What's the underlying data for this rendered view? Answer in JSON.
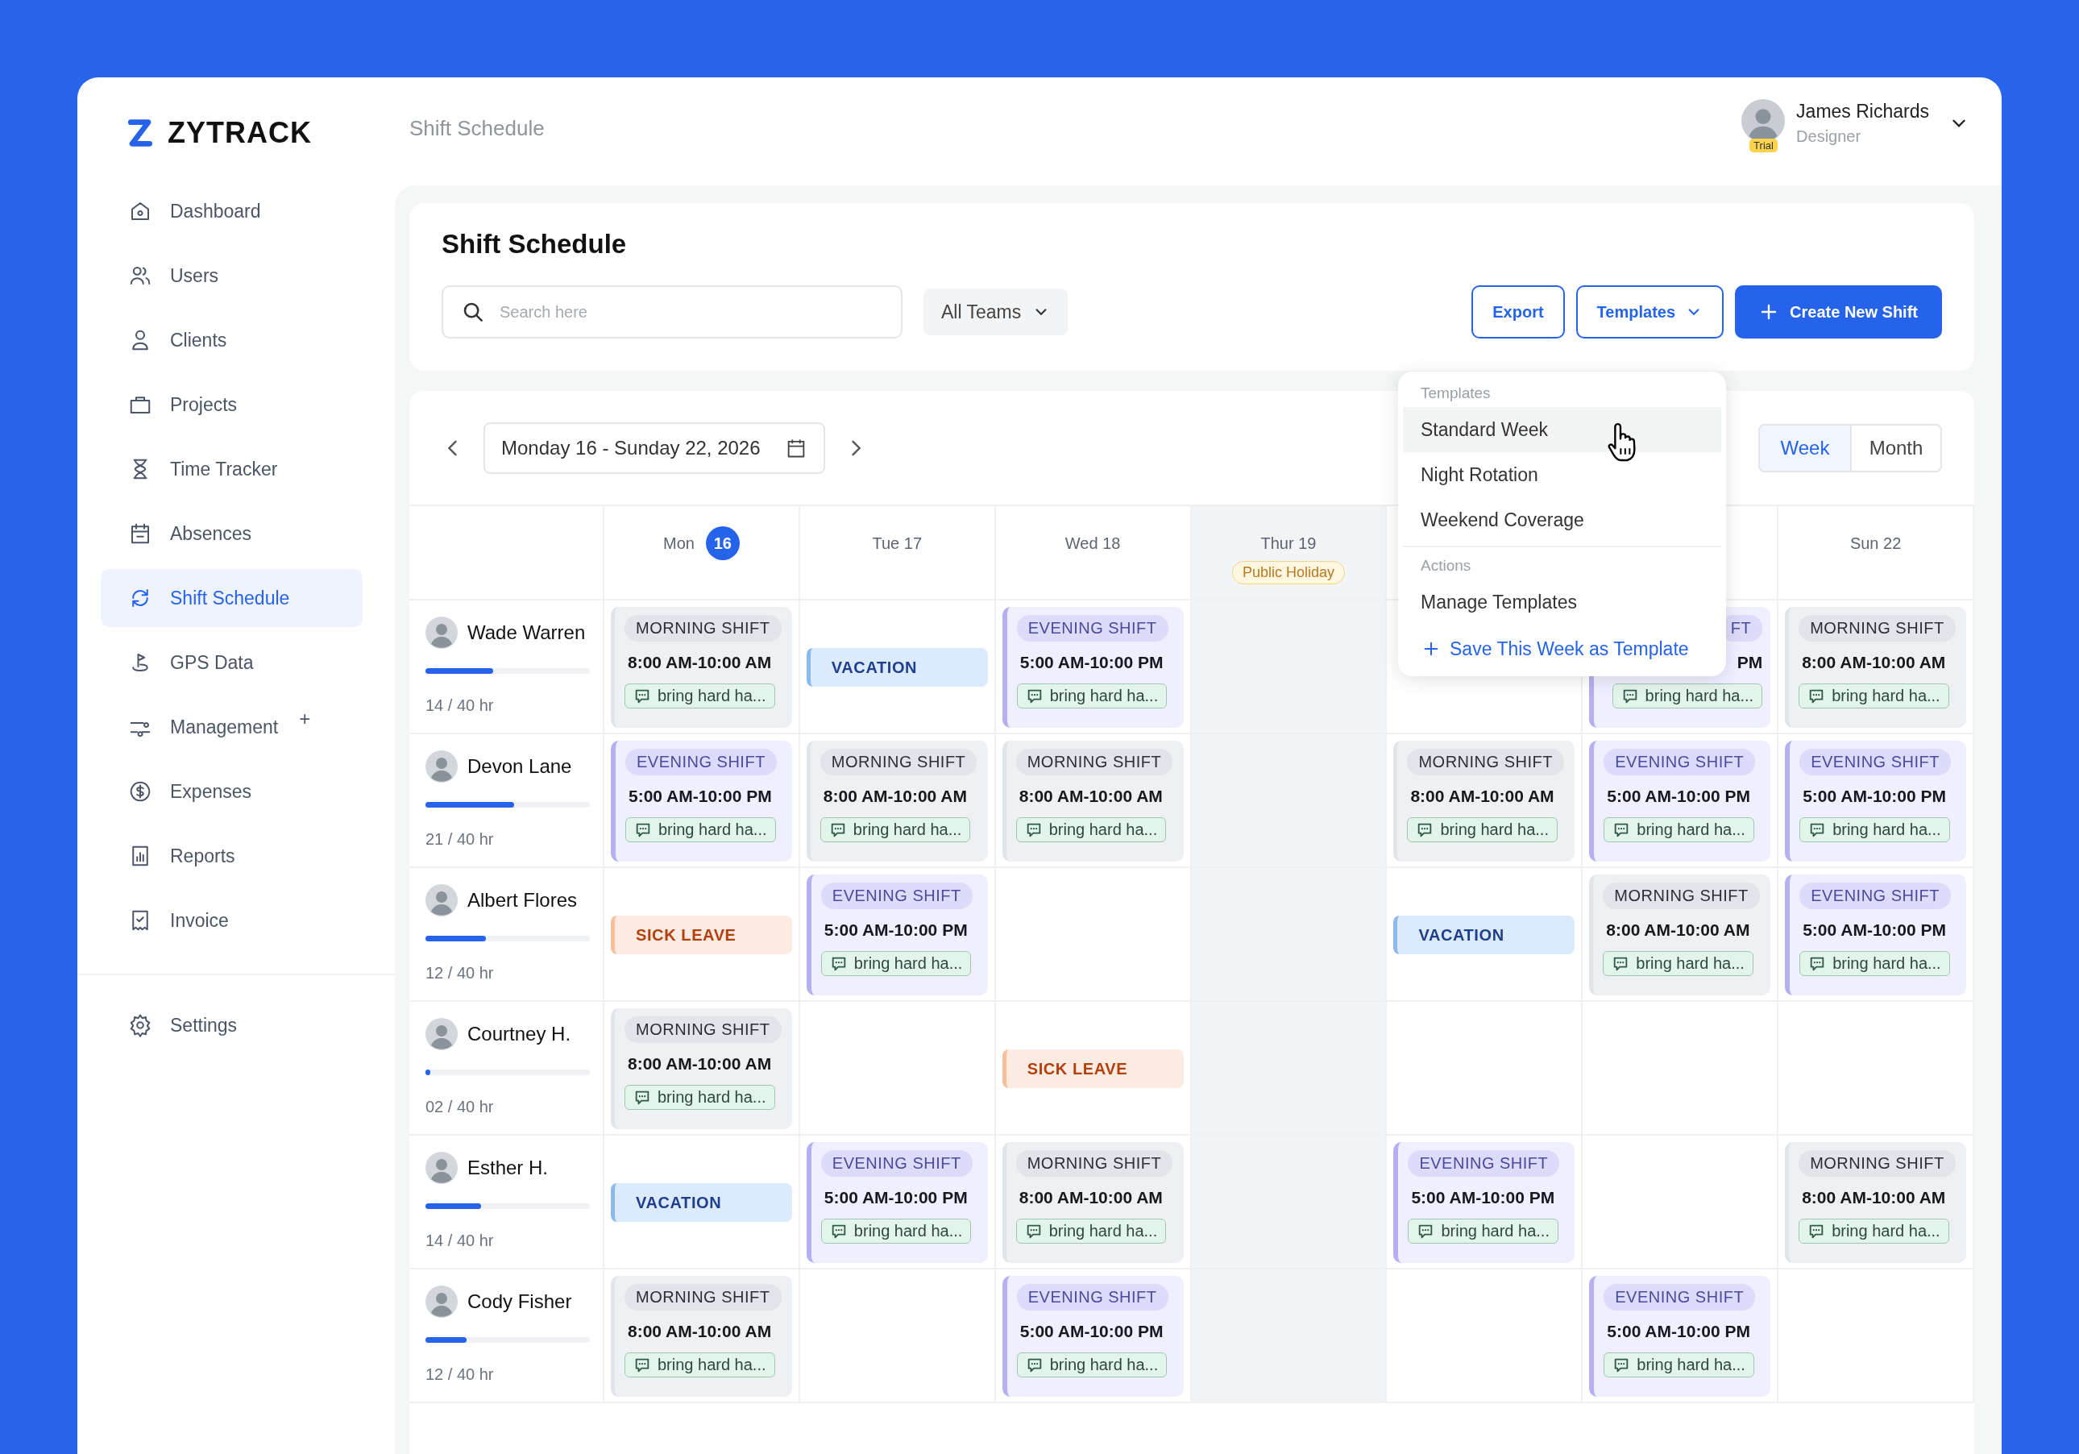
{
  "app": {
    "logo": "ZYTRACK"
  },
  "sidebar": {
    "items": [
      {
        "label": "Dashboard",
        "selected": false
      },
      {
        "label": "Users",
        "selected": false
      },
      {
        "label": "Clients",
        "selected": false
      },
      {
        "label": "Projects",
        "selected": false
      },
      {
        "label": "Time Tracker",
        "selected": false
      },
      {
        "label": "Absences",
        "selected": false
      },
      {
        "label": "Shift Schedule",
        "selected": true
      },
      {
        "label": "GPS Data",
        "selected": false
      },
      {
        "label": "Management",
        "selected": false,
        "badge": "+"
      },
      {
        "label": "Expenses",
        "selected": false
      },
      {
        "label": "Reports",
        "selected": false
      },
      {
        "label": "Invoice",
        "selected": false
      }
    ],
    "footer_items": [
      {
        "label": "Settings",
        "selected": false
      }
    ]
  },
  "header": {
    "breadcrumb": "Shift Schedule",
    "user": {
      "name": "James Richards",
      "role": "Designer",
      "badge": "Trial"
    }
  },
  "page": {
    "title": "Shift Schedule",
    "search": {
      "placeholder": "Search here"
    },
    "team_filter": "All Teams",
    "export": "Export",
    "templates": "Templates",
    "create": "Create New Shift"
  },
  "schedule": {
    "date_range": "Monday 16 - Sunday 22, 2026",
    "views": [
      {
        "label": "Week",
        "selected": true
      },
      {
        "label": "Month",
        "selected": false
      }
    ],
    "days": [
      {
        "label": "Mon",
        "badge": "16",
        "holiday": false
      },
      {
        "label": "Tue 17",
        "holiday": false
      },
      {
        "label": "Wed 18",
        "holiday": false
      },
      {
        "label": "Thur 19",
        "tag": "Public Holiday",
        "holiday": true
      },
      {
        "holiday": false
      },
      {
        "holiday": false
      },
      {
        "label": "Sun 22",
        "holiday": false
      }
    ],
    "rows": [
      {
        "name": "Wade Warren",
        "hours": "14 / 40 hr",
        "level": 0.41,
        "cells": [
          {
            "kind": "morning",
            "label": "MORNING SHIFT",
            "time": "8:00 AM-10:00 AM",
            "note": "bring hard ha..."
          },
          {
            "kind": "vacation",
            "label": "VACATION"
          },
          {
            "kind": "evening",
            "label": "EVENING SHIFT",
            "time": "5:00 AM-10:00 PM",
            "note": "bring hard ha..."
          },
          {
            "kind": "empty"
          },
          {
            "kind": "empty"
          },
          {
            "kind": "evening",
            "label": "FT",
            "time": "PM",
            "note": "bring hard ha...",
            "partial": true
          },
          {
            "kind": "morning",
            "label": "MORNING SHIFT",
            "time": "8:00 AM-10:00 AM",
            "note": "bring hard ha..."
          }
        ]
      },
      {
        "name": "Devon Lane",
        "hours": "21 / 40 hr",
        "level": 0.54,
        "cells": [
          {
            "kind": "evening",
            "label": "EVENING SHIFT",
            "time": "5:00 AM-10:00 PM",
            "note": "bring hard ha..."
          },
          {
            "kind": "morning",
            "label": "MORNING SHIFT",
            "time": "8:00 AM-10:00 AM",
            "note": "bring hard ha..."
          },
          {
            "kind": "morning",
            "label": "MORNING SHIFT",
            "time": "8:00 AM-10:00 AM",
            "note": "bring hard ha..."
          },
          {
            "kind": "empty"
          },
          {
            "kind": "morning",
            "label": "MORNING SHIFT",
            "time": "8:00 AM-10:00 AM",
            "note": "bring hard ha..."
          },
          {
            "kind": "evening",
            "label": "EVENING SHIFT",
            "time": "5:00 AM-10:00 PM",
            "note": "bring hard ha..."
          },
          {
            "kind": "evening",
            "label": "EVENING SHIFT",
            "time": "5:00 AM-10:00 PM",
            "note": "bring hard ha..."
          }
        ]
      },
      {
        "name": "Albert Flores",
        "hours": "12 / 40 hr",
        "level": 0.37,
        "cells": [
          {
            "kind": "sick",
            "label": "SICK LEAVE"
          },
          {
            "kind": "evening",
            "label": "EVENING SHIFT",
            "time": "5:00 AM-10:00 PM",
            "note": "bring hard ha..."
          },
          {
            "kind": "empty"
          },
          {
            "kind": "empty"
          },
          {
            "kind": "vacation",
            "label": "VACATION"
          },
          {
            "kind": "morning",
            "label": "MORNING SHIFT",
            "time": "8:00 AM-10:00 AM",
            "note": "bring hard ha..."
          },
          {
            "kind": "evening",
            "label": "EVENING SHIFT",
            "time": "5:00 AM-10:00 PM",
            "note": "bring hard ha..."
          }
        ]
      },
      {
        "name": "Courtney H.",
        "hours": "02 / 40 hr",
        "level": 0.03,
        "cells": [
          {
            "kind": "morning",
            "label": "MORNING SHIFT",
            "time": "8:00 AM-10:00 AM",
            "note": "bring hard ha..."
          },
          {
            "kind": "empty"
          },
          {
            "kind": "sick",
            "label": "SICK LEAVE"
          },
          {
            "kind": "empty"
          },
          {
            "kind": "empty"
          },
          {
            "kind": "empty"
          },
          {
            "kind": "empty"
          }
        ]
      },
      {
        "name": "Esther H.",
        "hours": "14 / 40 hr",
        "level": 0.34,
        "cells": [
          {
            "kind": "vacation",
            "label": "VACATION"
          },
          {
            "kind": "evening",
            "label": "EVENING SHIFT",
            "time": "5:00 AM-10:00 PM",
            "note": "bring hard ha..."
          },
          {
            "kind": "morning",
            "label": "MORNING SHIFT",
            "time": "8:00 AM-10:00 AM",
            "note": "bring hard ha..."
          },
          {
            "kind": "empty"
          },
          {
            "kind": "evening",
            "label": "EVENING SHIFT",
            "time": "5:00 AM-10:00 PM",
            "note": "bring hard ha..."
          },
          {
            "kind": "empty"
          },
          {
            "kind": "morning",
            "label": "MORNING SHIFT",
            "time": "8:00 AM-10:00 AM",
            "note": "bring hard ha..."
          }
        ]
      },
      {
        "name": "Cody Fisher",
        "hours": "12 / 40 hr",
        "level": 0.25,
        "cells": [
          {
            "kind": "morning",
            "label": "MORNING SHIFT",
            "time": "8:00 AM-10:00 AM",
            "note": "bring hard ha..."
          },
          {
            "kind": "empty"
          },
          {
            "kind": "evening",
            "label": "EVENING SHIFT",
            "time": "5:00 AM-10:00 PM",
            "note": "bring hard ha..."
          },
          {
            "kind": "empty"
          },
          {
            "kind": "empty"
          },
          {
            "kind": "evening",
            "label": "EVENING SHIFT",
            "time": "5:00 AM-10:00 PM",
            "note": "bring hard ha..."
          },
          {
            "kind": "empty"
          }
        ]
      }
    ]
  },
  "templates_menu": {
    "sections": [
      {
        "heading": "Templates",
        "items": [
          {
            "label": "Standard Week",
            "kind": "plain",
            "highlighted": true
          },
          {
            "label": "Night Rotation",
            "kind": "plain",
            "highlighted": false
          },
          {
            "label": "Weekend Coverage",
            "kind": "plain",
            "highlighted": false
          }
        ]
      },
      {
        "heading": "Actions",
        "items": [
          {
            "label": "Manage Templates",
            "kind": "plain",
            "highlighted": false
          },
          {
            "label": "Save This Week as Template",
            "kind": "add",
            "highlighted": false
          }
        ]
      }
    ]
  }
}
